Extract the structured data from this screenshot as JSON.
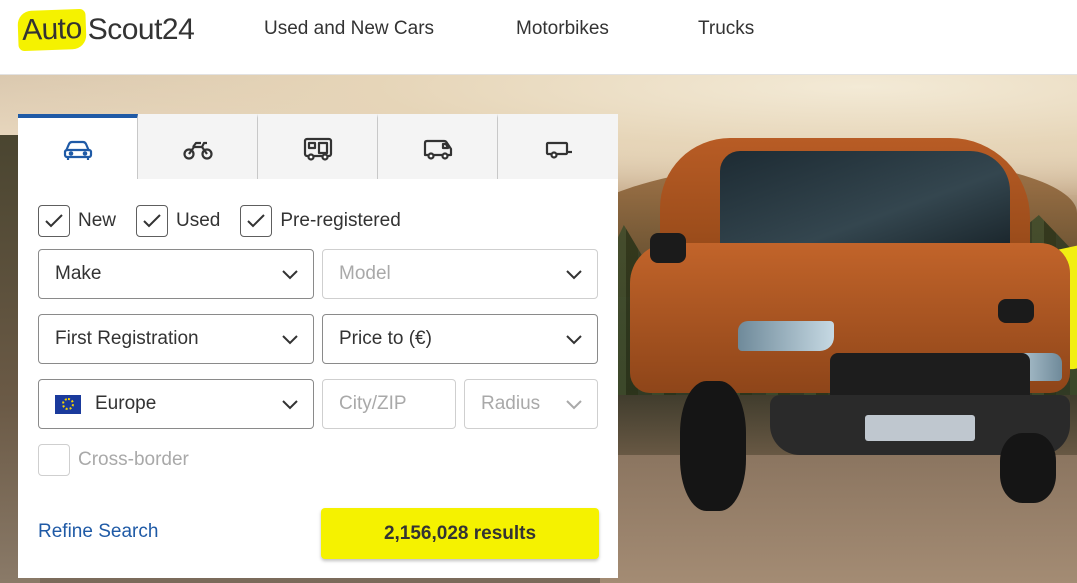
{
  "brand": {
    "logo_part1": "Auto",
    "logo_part2": "Scout24",
    "accent_color": "#f5f200",
    "link_color": "#1f5aa6"
  },
  "header": {
    "nav": [
      "Used and New Cars",
      "Motorbikes",
      "Trucks"
    ]
  },
  "search": {
    "tabs": [
      {
        "icon": "car-icon",
        "active": true
      },
      {
        "icon": "motorbike-icon",
        "active": false
      },
      {
        "icon": "motorhome-icon",
        "active": false
      },
      {
        "icon": "van-icon",
        "active": false
      },
      {
        "icon": "trailer-icon",
        "active": false
      }
    ],
    "conditions": [
      {
        "label": "New",
        "checked": true
      },
      {
        "label": "Used",
        "checked": true
      },
      {
        "label": "Pre-registered",
        "checked": true
      }
    ],
    "make": "Make",
    "model": "Model",
    "first_registration": "First Registration",
    "price_to": "Price to (€)",
    "country": "Europe",
    "city_zip_placeholder": "City/ZIP",
    "radius": "Radius",
    "cross_border": {
      "label": "Cross-border",
      "checked": false
    },
    "refine_label": "Refine Search",
    "results_label": "2,156,028 results"
  }
}
